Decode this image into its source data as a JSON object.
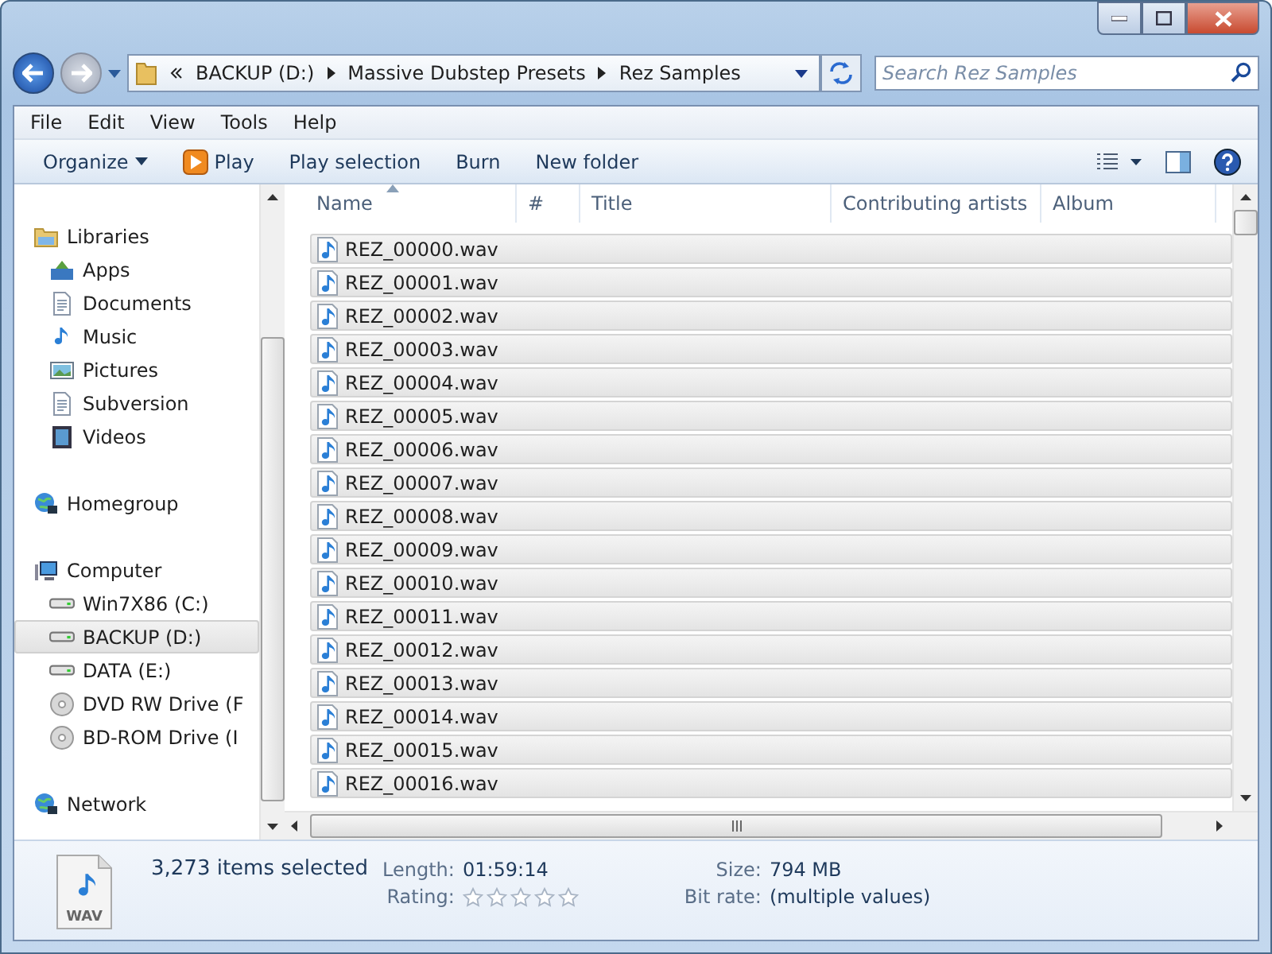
{
  "address_bar": {
    "crumbs": [
      "BACKUP (D:)",
      "Massive Dubstep Presets",
      "Rez Samples"
    ]
  },
  "search": {
    "placeholder": "Search Rez Samples"
  },
  "menu": [
    "File",
    "Edit",
    "View",
    "Tools",
    "Help"
  ],
  "toolbar": [
    "Organize",
    "Play",
    "Play selection",
    "Burn",
    "New folder"
  ],
  "sidebar": {
    "items": [
      {
        "label": "Libraries",
        "kind": "library",
        "selected": false,
        "children": [
          {
            "label": "Apps",
            "kind": "apps",
            "selected": false
          },
          {
            "label": "Documents",
            "kind": "document",
            "selected": false
          },
          {
            "label": "Music",
            "kind": "music",
            "selected": false
          },
          {
            "label": "Pictures",
            "kind": "picture",
            "selected": false
          },
          {
            "label": "Subversion",
            "kind": "document",
            "selected": false
          },
          {
            "label": "Videos",
            "kind": "video",
            "selected": false
          }
        ]
      },
      {
        "label": "Homegroup",
        "kind": "network",
        "selected": false
      },
      {
        "label": "Computer",
        "kind": "computer",
        "selected": false,
        "children": [
          {
            "label": "Win7X86 (C:)",
            "kind": "drive",
            "selected": false
          },
          {
            "label": "BACKUP (D:)",
            "kind": "drive",
            "selected": true
          },
          {
            "label": "DATA (E:)",
            "kind": "drive",
            "selected": false
          },
          {
            "label": "DVD RW Drive (F",
            "kind": "disc",
            "selected": false
          },
          {
            "label": "BD-ROM Drive (I",
            "kind": "disc",
            "selected": false
          }
        ]
      },
      {
        "label": "Network",
        "kind": "network",
        "selected": false
      }
    ]
  },
  "table": {
    "columns": [
      "Name",
      "#",
      "Title",
      "Contributing artists",
      "Album"
    ],
    "rows": [
      {
        "name": "REZ_00000.wav",
        "selected": true
      },
      {
        "name": "REZ_00001.wav",
        "selected": true
      },
      {
        "name": "REZ_00002.wav",
        "selected": true
      },
      {
        "name": "REZ_00003.wav",
        "selected": true
      },
      {
        "name": "REZ_00004.wav",
        "selected": true
      },
      {
        "name": "REZ_00005.wav",
        "selected": true
      },
      {
        "name": "REZ_00006.wav",
        "selected": true
      },
      {
        "name": "REZ_00007.wav",
        "selected": true
      },
      {
        "name": "REZ_00008.wav",
        "selected": true
      },
      {
        "name": "REZ_00009.wav",
        "selected": true
      },
      {
        "name": "REZ_00010.wav",
        "selected": true
      },
      {
        "name": "REZ_00011.wav",
        "selected": true
      },
      {
        "name": "REZ_00012.wav",
        "selected": true
      },
      {
        "name": "REZ_00013.wav",
        "selected": true
      },
      {
        "name": "REZ_00014.wav",
        "selected": true
      },
      {
        "name": "REZ_00015.wav",
        "selected": true
      },
      {
        "name": "REZ_00016.wav",
        "selected": true
      }
    ]
  },
  "details": {
    "file_type": "WAV",
    "summary": "3,273 items selected",
    "fields": [
      {
        "label": "Length:",
        "value": "01:59:14"
      },
      {
        "label": "Size:",
        "value": "794 MB"
      },
      {
        "label": "Rating:",
        "kind": "rating",
        "stars": 0
      },
      {
        "label": "Bit rate:",
        "value": "(multiple values)"
      }
    ]
  }
}
